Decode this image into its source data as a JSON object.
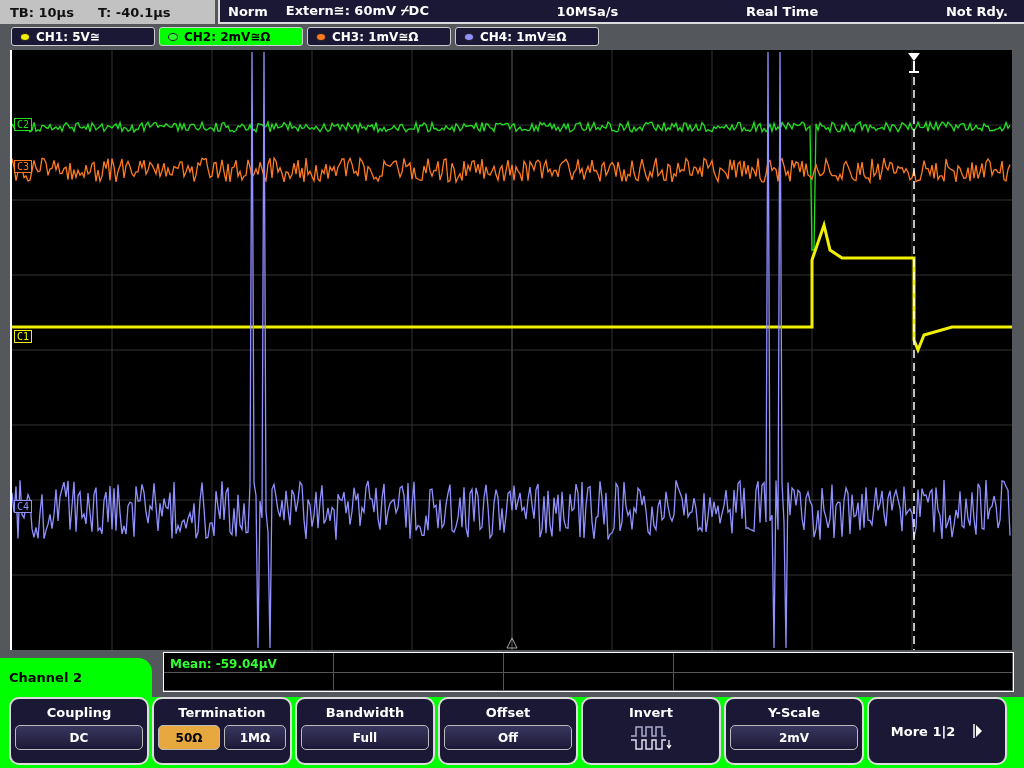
{
  "status_bar": {
    "timebase": "TB: 10µs",
    "trigger_time": "T: -40.1µs",
    "mode": "Norm",
    "trigger_source": "Extern≅: 60mV ⌿DC",
    "sample_rate": "10MSa/s",
    "acquisition": "Real Time",
    "state": "Not Rdy."
  },
  "channels": [
    {
      "label": "CH1: 5V≅",
      "color": "#f0f000",
      "selected": false
    },
    {
      "label": "CH2: 2mV≅Ω",
      "color": "#30ff30",
      "selected": true
    },
    {
      "label": "CH3: 1mV≅Ω",
      "color": "#ff7a20",
      "selected": false
    },
    {
      "label": "CH4: 1mV≅Ω",
      "color": "#9090ff",
      "selected": false
    }
  ],
  "traces": [
    {
      "label": "C2",
      "color": "#20e020",
      "kind": "noise"
    },
    {
      "label": "C3",
      "color": "#ff7a20",
      "kind": "noise"
    },
    {
      "label": "C1",
      "color": "#f0f000",
      "kind": "step"
    },
    {
      "label": "C4",
      "color": "#9090ff",
      "kind": "burst"
    }
  ],
  "menu": {
    "title": "Channel 2",
    "measurement": "Mean: -59.04µV"
  },
  "softkeys": [
    {
      "kind": "value",
      "label": "Coupling",
      "values": [
        {
          "text": "DC",
          "selected": false
        }
      ]
    },
    {
      "kind": "options",
      "label": "Termination",
      "values": [
        {
          "text": "50Ω",
          "selected": true
        },
        {
          "text": "1MΩ",
          "selected": false
        }
      ]
    },
    {
      "kind": "value",
      "label": "Bandwidth",
      "values": [
        {
          "text": "Full",
          "selected": false
        }
      ]
    },
    {
      "kind": "value",
      "label": "Offset",
      "values": [
        {
          "text": "Off",
          "selected": false
        }
      ]
    },
    {
      "kind": "icon",
      "label": "Invert"
    },
    {
      "kind": "value",
      "label": "Y-Scale",
      "values": [
        {
          "text": "2mV",
          "selected": false
        }
      ]
    },
    {
      "kind": "page",
      "label": "More 1|2"
    }
  ]
}
